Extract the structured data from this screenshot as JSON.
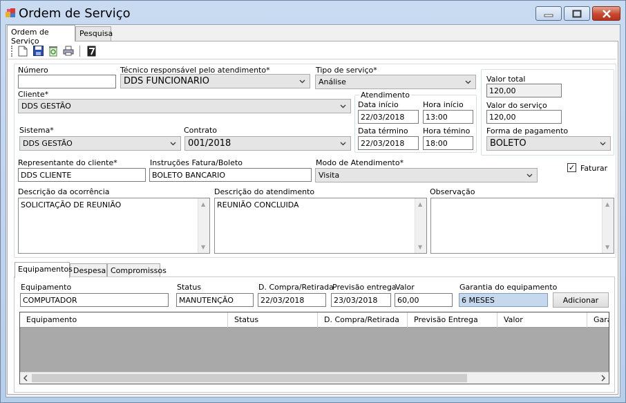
{
  "window": {
    "title": "Ordem de Serviço"
  },
  "tabs": [
    {
      "label": "Ordem de Serviço"
    },
    {
      "label": "Pesquisa"
    }
  ],
  "toolbar": {
    "icons": [
      "new-document-icon",
      "save-icon",
      "recycle-icon",
      "print-icon",
      "report-icon"
    ]
  },
  "form": {
    "numero": {
      "label": "Número",
      "value": ""
    },
    "tecnico": {
      "label": "Técnico responsável pelo atendimento*",
      "value": "DDS FUNCIONARIO"
    },
    "tipo_servico": {
      "label": "Tipo de serviço*",
      "value": "Análise"
    },
    "cliente": {
      "label": "Cliente*",
      "value": "DDS GESTÃO"
    },
    "sistema": {
      "label": "Sistema*",
      "value": "DDS GESTÃO"
    },
    "contrato": {
      "label": "Contrato",
      "value": "001/2018"
    },
    "atendimento": {
      "title": "Atendimento",
      "data_inicio": {
        "label": "Data início",
        "value": "22/03/2018"
      },
      "hora_inicio": {
        "label": "Hora início",
        "value": "13:00"
      },
      "data_termino": {
        "label": "Data término",
        "value": "22/03/2018"
      },
      "hora_termino": {
        "label": "Hora témino",
        "value": "18:00"
      }
    },
    "valor_total": {
      "label": "Valor total",
      "value": "120,00"
    },
    "valor_servico": {
      "label": "Valor do serviço",
      "value": "120,00"
    },
    "forma_pagamento": {
      "label": "Forma de pagamento",
      "value": "BOLETO"
    },
    "representante": {
      "label": "Representante do cliente*",
      "value": "DDS CLIENTE"
    },
    "instrucoes": {
      "label": "Instruções Fatura/Boleto",
      "value": "BOLETO BANCARIO"
    },
    "modo_atendimento": {
      "label": "Modo de Atendimento*",
      "value": "Visita"
    },
    "faturar": {
      "label": "Faturar",
      "checked": true,
      "mark": "✓"
    },
    "descricao_ocorrencia": {
      "label": "Descrição da ocorrência",
      "value": "SOLICITAÇÃO DE REUNIÃO"
    },
    "descricao_atendimento": {
      "label": "Descrição do atendimento",
      "value": "REUNIÃO CONCLUIDA"
    },
    "observacao": {
      "label": "Observação",
      "value": ""
    }
  },
  "subtabs": [
    {
      "label": "Equipamentos"
    },
    {
      "label": "Despesa"
    },
    {
      "label": "Compromissos"
    }
  ],
  "equipamento": {
    "equipamento": {
      "label": "Equipamento",
      "value": "COMPUTADOR"
    },
    "status": {
      "label": "Status",
      "value": "MANUTENÇÃO"
    },
    "compra": {
      "label": "D. Compra/Retirada",
      "value": "22/03/2018"
    },
    "previsao": {
      "label": "Previsão entrega",
      "value": "23/03/2018"
    },
    "valor": {
      "label": "Valor",
      "value": "60,00"
    },
    "garantia": {
      "label": "Garantia do equipamento",
      "value": "6 MESES"
    },
    "add_button": "Adicionar"
  },
  "grid": {
    "columns": [
      "Equipamento",
      "Status",
      "D. Compra/Retirada",
      "Previsão Entrega",
      "Valor",
      "Gara"
    ],
    "rows": []
  }
}
